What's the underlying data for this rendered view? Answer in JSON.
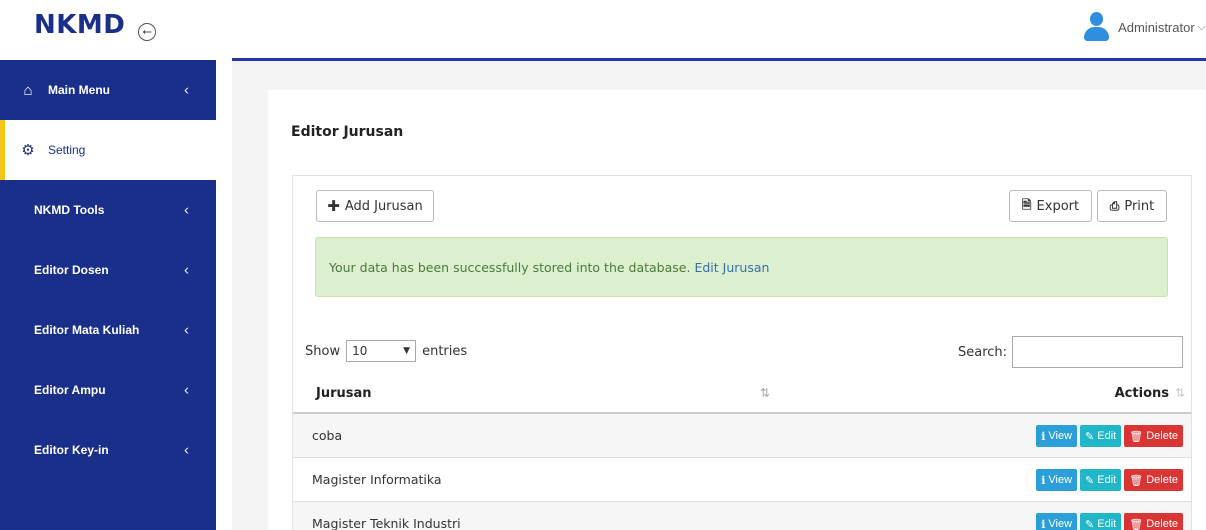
{
  "header": {
    "brand": "NKMD",
    "user": "Administrator",
    "colors": {
      "brand": "#1a2f8a",
      "accent_line": "#2436a8"
    }
  },
  "sidebar": {
    "items": [
      {
        "label": "Main Menu",
        "icon": "home-icon",
        "has_chevron": true
      },
      {
        "label": "Setting",
        "icon": "gear-icon",
        "active": true
      },
      {
        "label": "NKMD Tools",
        "has_chevron": true
      },
      {
        "label": "Editor Dosen",
        "has_chevron": true
      },
      {
        "label": "Editor Mata Kuliah",
        "has_chevron": true
      },
      {
        "label": "Editor Ampu",
        "has_chevron": true
      },
      {
        "label": "Editor Key-in",
        "has_chevron": true
      }
    ]
  },
  "main": {
    "title": "Editor Jurusan",
    "toolbar": {
      "add_label": "Add Jurusan",
      "export_label": "Export",
      "print_label": "Print"
    },
    "alert": {
      "message": "Your data has been successfully stored into the database.",
      "link": "Edit Jurusan"
    },
    "table_controls": {
      "show_label": "Show",
      "entries_value": "10",
      "entries_label": "entries",
      "search_label": "Search:"
    },
    "table": {
      "columns": [
        "Jurusan",
        "Actions"
      ],
      "rows": [
        {
          "jurusan": "coba"
        },
        {
          "jurusan": "Magister Informatika"
        },
        {
          "jurusan": "Magister Teknik Industri"
        }
      ],
      "action_labels": {
        "view": "View",
        "edit": "Edit",
        "delete": "Delete"
      }
    }
  }
}
